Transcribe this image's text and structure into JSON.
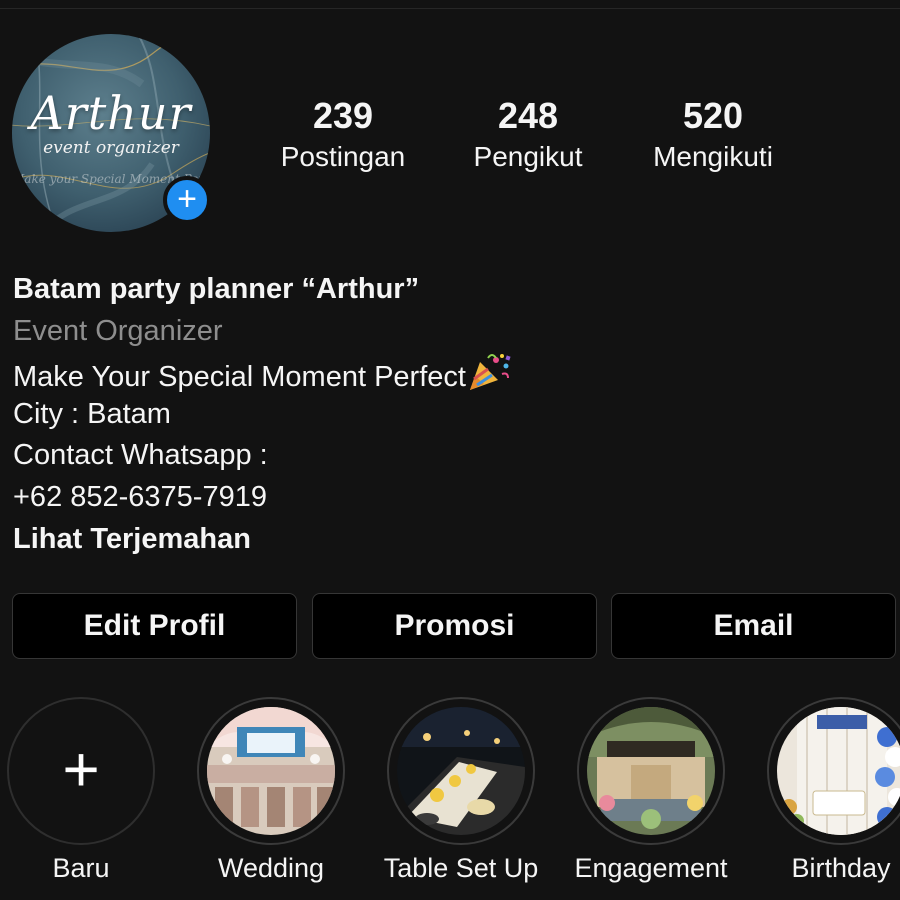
{
  "profile": {
    "logo_text": "Arthur",
    "logo_subtext": "event organizer",
    "logo_tagline": "Make your Special Moment Perfect",
    "avatar_badge": "+"
  },
  "stats": [
    {
      "value": "239",
      "label": "Postingan"
    },
    {
      "value": "248",
      "label": "Pengikut"
    },
    {
      "value": "520",
      "label": "Mengikuti"
    }
  ],
  "bio": {
    "name": "Batam party planner “Arthur”",
    "category": "Event Organizer",
    "line1": "Make Your Special Moment Perfect",
    "line1_emoji": "party-popper-icon",
    "line2": "City : Batam",
    "line3": "Contact Whatsapp :",
    "line4": "+62 852-6375-7919",
    "translate_link": "Lihat Terjemahan"
  },
  "actions": {
    "edit": "Edit Profil",
    "promote": "Promosi",
    "email": "Email"
  },
  "highlights": [
    {
      "label": "Baru",
      "icon": "plus-icon"
    },
    {
      "label": "Wedding"
    },
    {
      "label": "Table Set Up"
    },
    {
      "label": "Engagement"
    },
    {
      "label": "Birthday"
    }
  ],
  "colors": {
    "background": "#121212",
    "text": "#f5f5f5",
    "secondary_text": "#8e8e8e",
    "accent_blue": "#1f8ef1",
    "button_border": "#363636"
  }
}
